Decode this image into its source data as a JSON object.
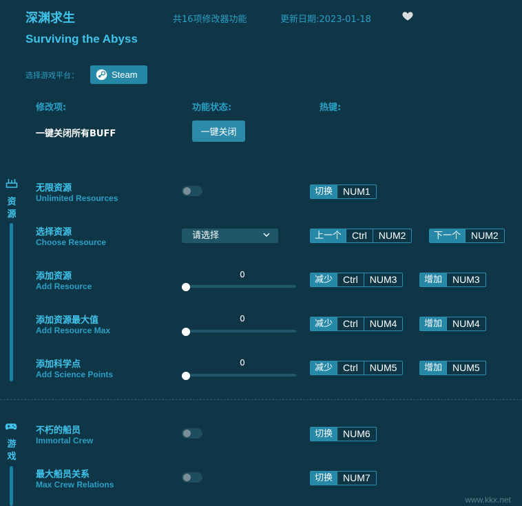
{
  "header": {
    "title_cn": "深渊求生",
    "title_en": "Surviving the Abyss",
    "feature_count": "共16项修改器功能",
    "update_date": "更新日期:2023-01-18"
  },
  "platform": {
    "label": "选择游戏平台：",
    "selected": "Steam"
  },
  "columns": {
    "item": "修改项:",
    "status": "功能状态:",
    "hotkey": "热键:"
  },
  "buff": {
    "label": "一键关闭所有BUFF",
    "button": "一键关闭"
  },
  "sections": [
    {
      "label_1": "资",
      "label_2": "源",
      "icon": "resource-icon"
    },
    {
      "label_1": "游",
      "label_2": "戏",
      "icon": "gamepad-icon"
    }
  ],
  "rows": [
    {
      "cn": "无限资源",
      "en": "Unlimited Resources",
      "control": "toggle",
      "on": false,
      "hotkeys": [
        {
          "action": "切换",
          "keys": [
            "NUM1"
          ]
        }
      ]
    },
    {
      "cn": "选择资源",
      "en": "Choose Resource",
      "control": "dropdown",
      "value": "请选择",
      "hotkeys": [
        {
          "action": "上一个",
          "keys": [
            "Ctrl",
            "NUM2"
          ]
        },
        {
          "action": "下一个",
          "keys": [
            "NUM2"
          ]
        }
      ]
    },
    {
      "cn": "添加资源",
      "en": "Add Resource",
      "control": "slider",
      "value": "0",
      "hotkeys": [
        {
          "action": "减少",
          "keys": [
            "Ctrl",
            "NUM3"
          ]
        },
        {
          "action": "增加",
          "keys": [
            "NUM3"
          ]
        }
      ]
    },
    {
      "cn": "添加资源最大值",
      "en": "Add Resource Max",
      "control": "slider",
      "value": "0",
      "hotkeys": [
        {
          "action": "减少",
          "keys": [
            "Ctrl",
            "NUM4"
          ]
        },
        {
          "action": "增加",
          "keys": [
            "NUM4"
          ]
        }
      ]
    },
    {
      "cn": "添加科学点",
      "en": "Add Science Points",
      "control": "slider",
      "value": "0",
      "hotkeys": [
        {
          "action": "减少",
          "keys": [
            "Ctrl",
            "NUM5"
          ]
        },
        {
          "action": "增加",
          "keys": [
            "NUM5"
          ]
        }
      ]
    },
    {
      "cn": "不朽的船员",
      "en": "Immortal Crew",
      "control": "toggle",
      "on": false,
      "hotkeys": [
        {
          "action": "切换",
          "keys": [
            "NUM6"
          ]
        }
      ]
    },
    {
      "cn": "最大船员关系",
      "en": "Max Crew Relations",
      "control": "toggle",
      "on": false,
      "hotkeys": [
        {
          "action": "切换",
          "keys": [
            "NUM7"
          ]
        }
      ]
    }
  ],
  "watermark": "www.kkx.net",
  "colors": {
    "background": "#0f3646",
    "accent": "#3fc3ea",
    "button": "#2488a6"
  }
}
